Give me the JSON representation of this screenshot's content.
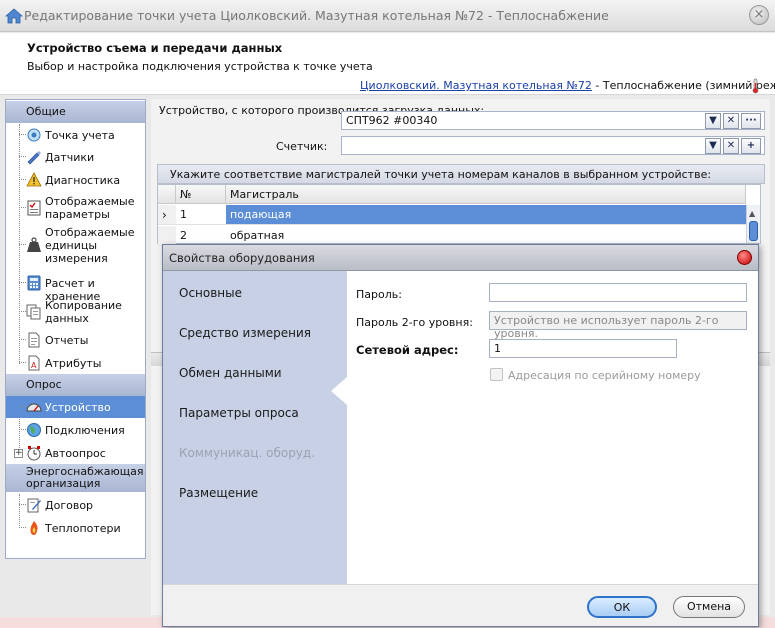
{
  "window": {
    "title": "Редактирование точки учета Циолковский. Мазутная котельная №72 - Теплоснабжение",
    "close_glyph": "×"
  },
  "header": {
    "title": "Устройство съема и передачи данных",
    "subtitle": "Выбор и настройка подключения устройства к точке учета",
    "link": "Циолковский. Мазутная котельная №72",
    "suffix": " - Теплоснабжение (зимний режим)"
  },
  "sidebar": {
    "groups": [
      "Общие",
      "Опрос",
      "Энергоснабжающая организация"
    ],
    "items": [
      {
        "label": "Точка учета",
        "icon": "target-icon"
      },
      {
        "label": "Датчики",
        "icon": "pencil-sensor-icon"
      },
      {
        "label": "Диагностика",
        "icon": "warning-icon"
      },
      {
        "label": "Отображаемые параметры",
        "icon": "checklist-icon"
      },
      {
        "label": "Отображаемые единицы измерения",
        "icon": "weight-icon"
      },
      {
        "label": "Расчет и хранение",
        "icon": "calculator-icon"
      },
      {
        "label": "Копирование данных",
        "icon": "copy-icon"
      },
      {
        "label": "Отчеты",
        "icon": "report-icon"
      },
      {
        "label": "Атрибуты",
        "icon": "attributes-icon"
      },
      {
        "label": "Устройство",
        "icon": "gauge-icon"
      },
      {
        "label": "Подключения",
        "icon": "globe-icon"
      },
      {
        "label": "Автоопрос",
        "icon": "clock-icon"
      },
      {
        "label": "Договор",
        "icon": "contract-icon"
      },
      {
        "label": "Теплопотери",
        "icon": "flame-icon"
      }
    ]
  },
  "form": {
    "device_label": "Устройство, с которого производится загрузка данных:",
    "device_value": "СПТ962 #00340",
    "meter_label": "Счетчик:",
    "meter_value": "",
    "btn_down": "▼",
    "btn_clear": "✕",
    "btn_more": "···",
    "btn_add": "+"
  },
  "grid": {
    "caption": "Укажите соответствие магистралей точки учета номерам каналов в выбранном устройстве:",
    "columns": [
      "№",
      "Магистраль"
    ],
    "rows": [
      {
        "num": "1",
        "name": "подающая"
      },
      {
        "num": "2",
        "name": "обратная"
      }
    ],
    "row_marker": "›"
  },
  "dialog": {
    "title": "Свойства оборудования",
    "nav": [
      {
        "label": "Основные",
        "disabled": false
      },
      {
        "label": "Средство измерения",
        "disabled": false
      },
      {
        "label": "Обмен данными",
        "disabled": false
      },
      {
        "label": "Параметры опроса",
        "disabled": false
      },
      {
        "label": "Коммуникац. оборуд.",
        "disabled": true
      },
      {
        "label": "Размещение",
        "disabled": false
      }
    ],
    "password_label": "Пароль:",
    "password_value": "",
    "password2_label": "Пароль 2-го уровня:",
    "password2_placeholder": "Устройство не использует пароль 2-го уровня.",
    "address_label": "Сетевой адрес:",
    "address_value": "1",
    "serial_label": "Адресация по серийному номеру",
    "ok": "ОК",
    "cancel": "Отмена"
  },
  "colors": {
    "accent": "#5b8ed6",
    "link": "#1a3fa6",
    "nav_bg": "#c7d0e4",
    "group_bg": "#b3bfda"
  }
}
